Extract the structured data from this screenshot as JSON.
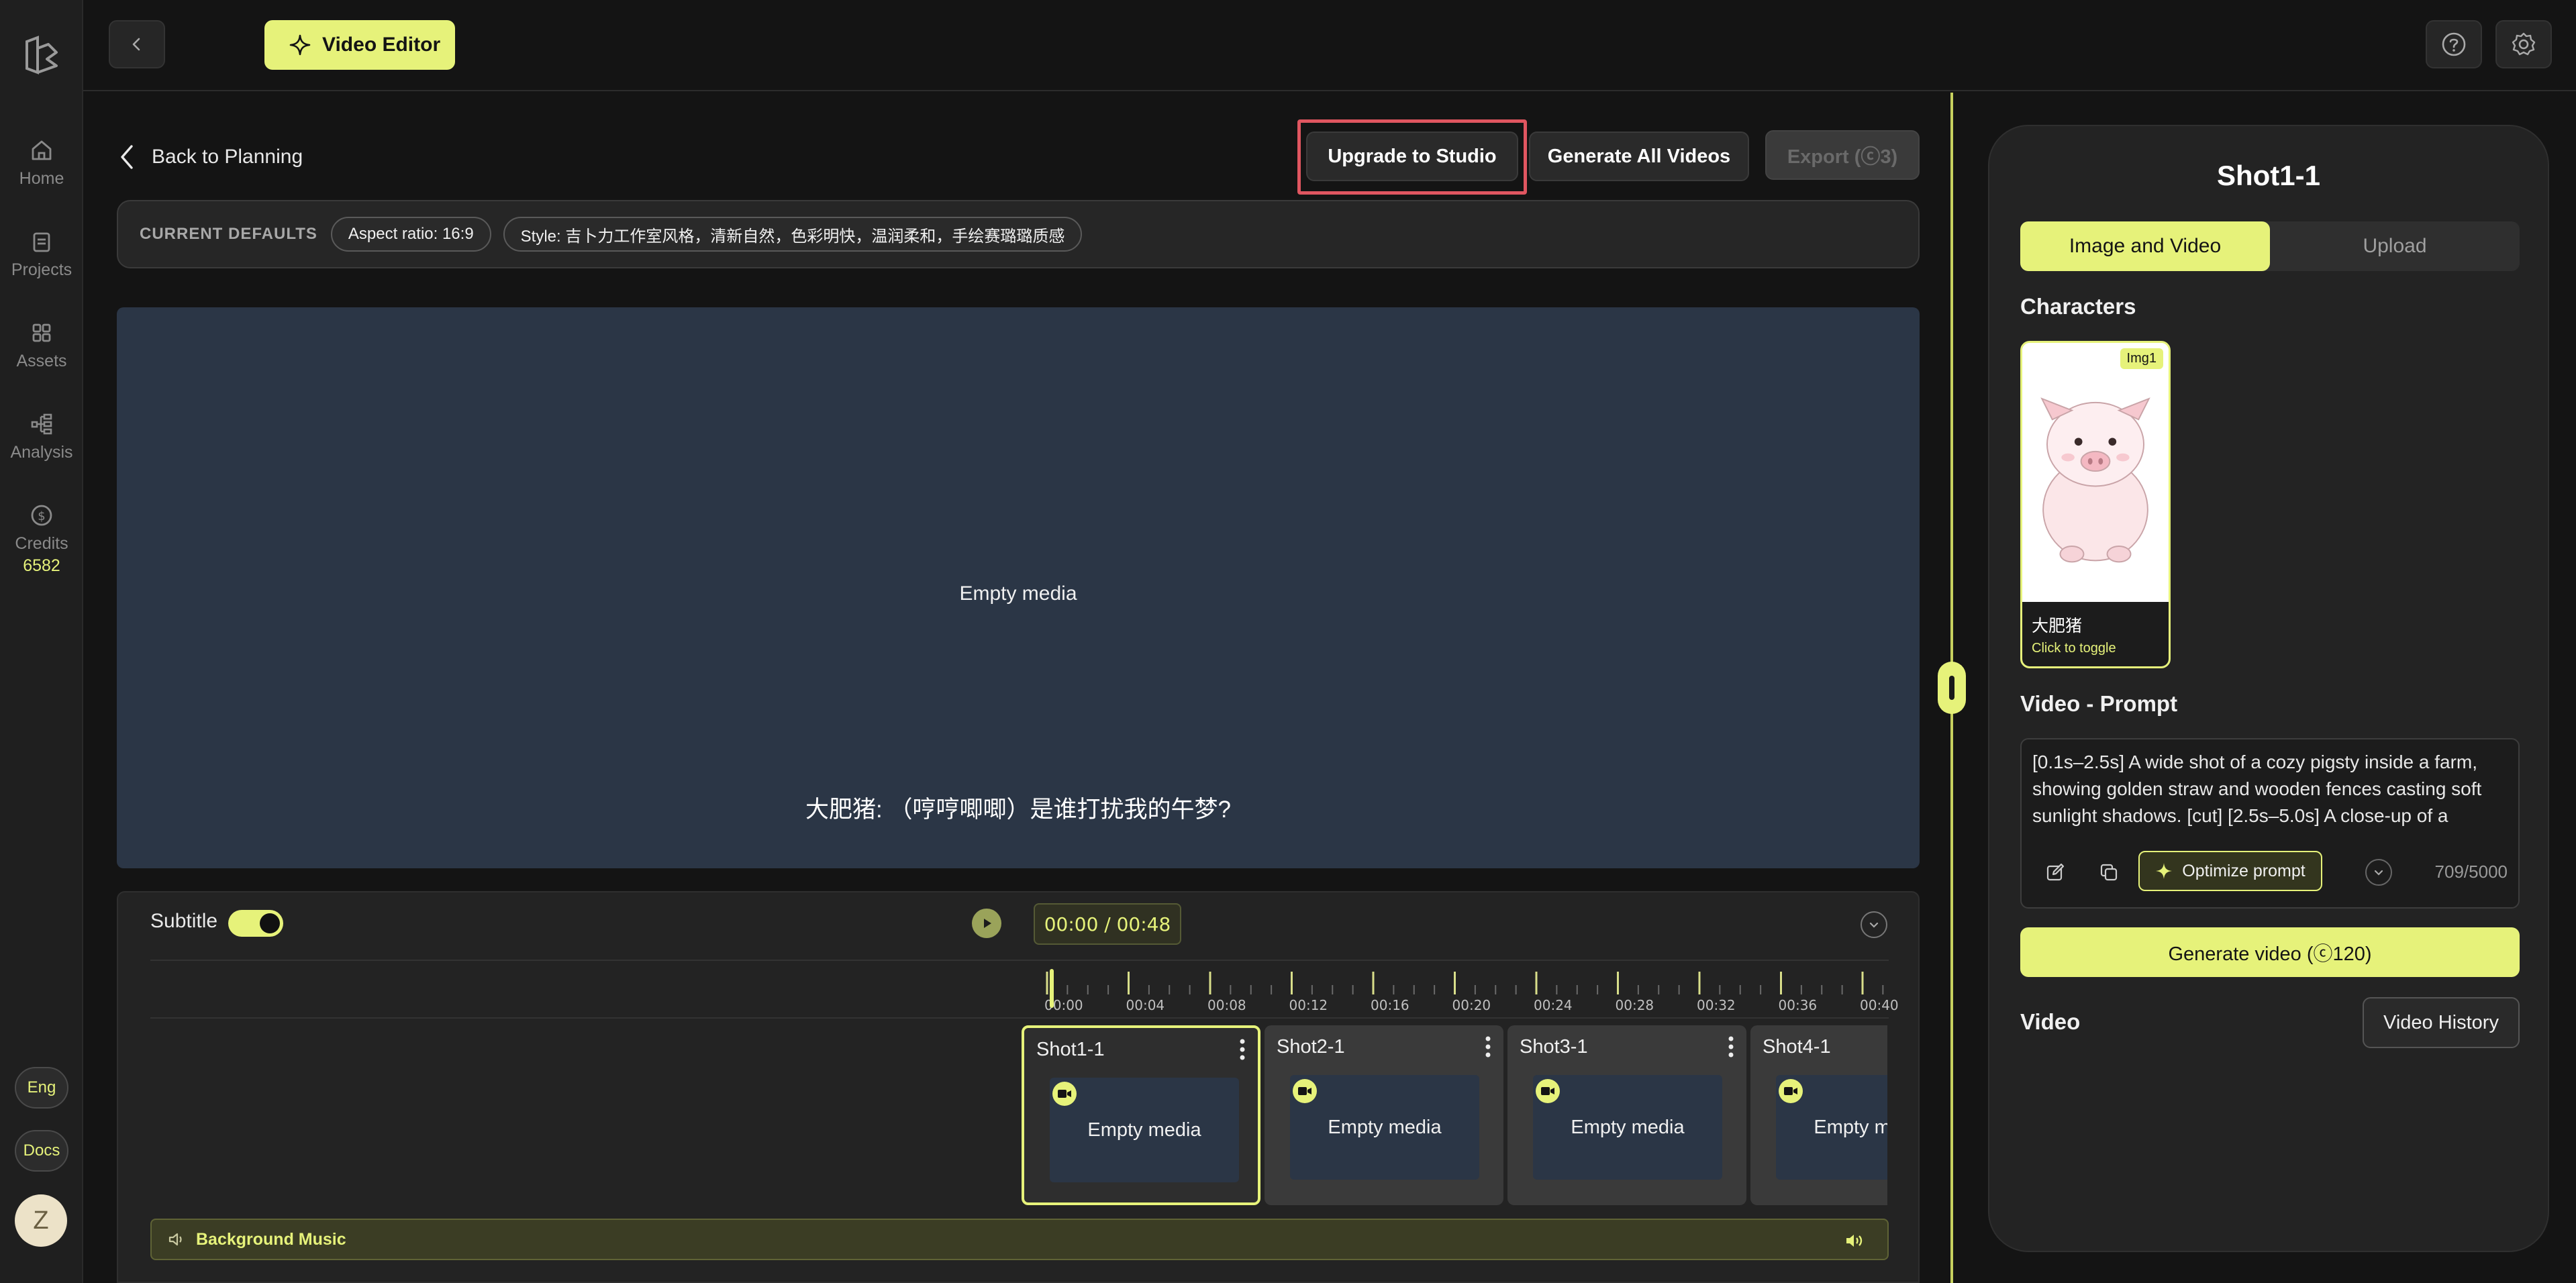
{
  "nav": {
    "items": [
      {
        "label": "Home",
        "icon": "home-icon"
      },
      {
        "label": "Projects",
        "icon": "clipboard-icon"
      },
      {
        "label": "Assets",
        "icon": "grid-icon"
      },
      {
        "label": "Analysis",
        "icon": "tree-icon"
      },
      {
        "label": "Credits",
        "icon": "dollar-icon"
      }
    ],
    "credits_value": "6582",
    "lang": "Eng",
    "docs": "Docs",
    "avatar": "Z"
  },
  "topbar": {
    "title": "Video Editor"
  },
  "main": {
    "back_label": "Back to Planning",
    "buttons": {
      "upgrade": "Upgrade to Studio",
      "generate_all": "Generate All Videos",
      "export": "Export (ⓒ3)"
    },
    "defaults": {
      "label": "CURRENT DEFAULTS",
      "aspect": "Aspect ratio: 16:9",
      "style": "Style: 吉卜力工作室风格，清新自然，色彩明快，温润柔和，手绘赛璐璐质感"
    },
    "preview": {
      "empty": "Empty media",
      "subtitle": "大肥猪: （哼哼唧唧）是谁打扰我的午梦?"
    }
  },
  "timeline": {
    "subtitle_label": "Subtitle",
    "subtitle_on": true,
    "time": "00:00 / 00:48",
    "ticks": [
      "00:00",
      "00:04",
      "00:08",
      "00:12",
      "00:16",
      "00:20",
      "00:24",
      "00:28",
      "00:32",
      "00:36",
      "00:40"
    ],
    "clips": [
      {
        "name": "Shot1-1",
        "media": "Empty media",
        "active": true
      },
      {
        "name": "Shot2-1",
        "media": "Empty media",
        "active": false
      },
      {
        "name": "Shot3-1",
        "media": "Empty media",
        "active": false
      },
      {
        "name": "Shot4-1",
        "media": "Empty media",
        "active": false
      }
    ],
    "bgm_label": "Background Music"
  },
  "panel": {
    "title": "Shot1-1",
    "tabs": [
      "Image and Video",
      "Upload"
    ],
    "characters_heading": "Characters",
    "character": {
      "badge": "Img1",
      "name": "大肥猪",
      "hint": "Click to toggle"
    },
    "prompt_heading": "Video - Prompt",
    "prompt_text": "[0.1s–2.5s] A wide shot of a cozy pigsty inside a farm, showing golden straw and wooden fences casting soft sunlight shadows. [cut] [2.5s–5.0s] A close-up of a",
    "optimize": "Optimize prompt",
    "count": "709/5000",
    "generate": "Generate video (ⓒ120)",
    "video_heading": "Video",
    "history": "Video History"
  },
  "colors": {
    "accent": "#e6f27a",
    "media_bg": "#2b3646",
    "highlight": "#e05660"
  }
}
